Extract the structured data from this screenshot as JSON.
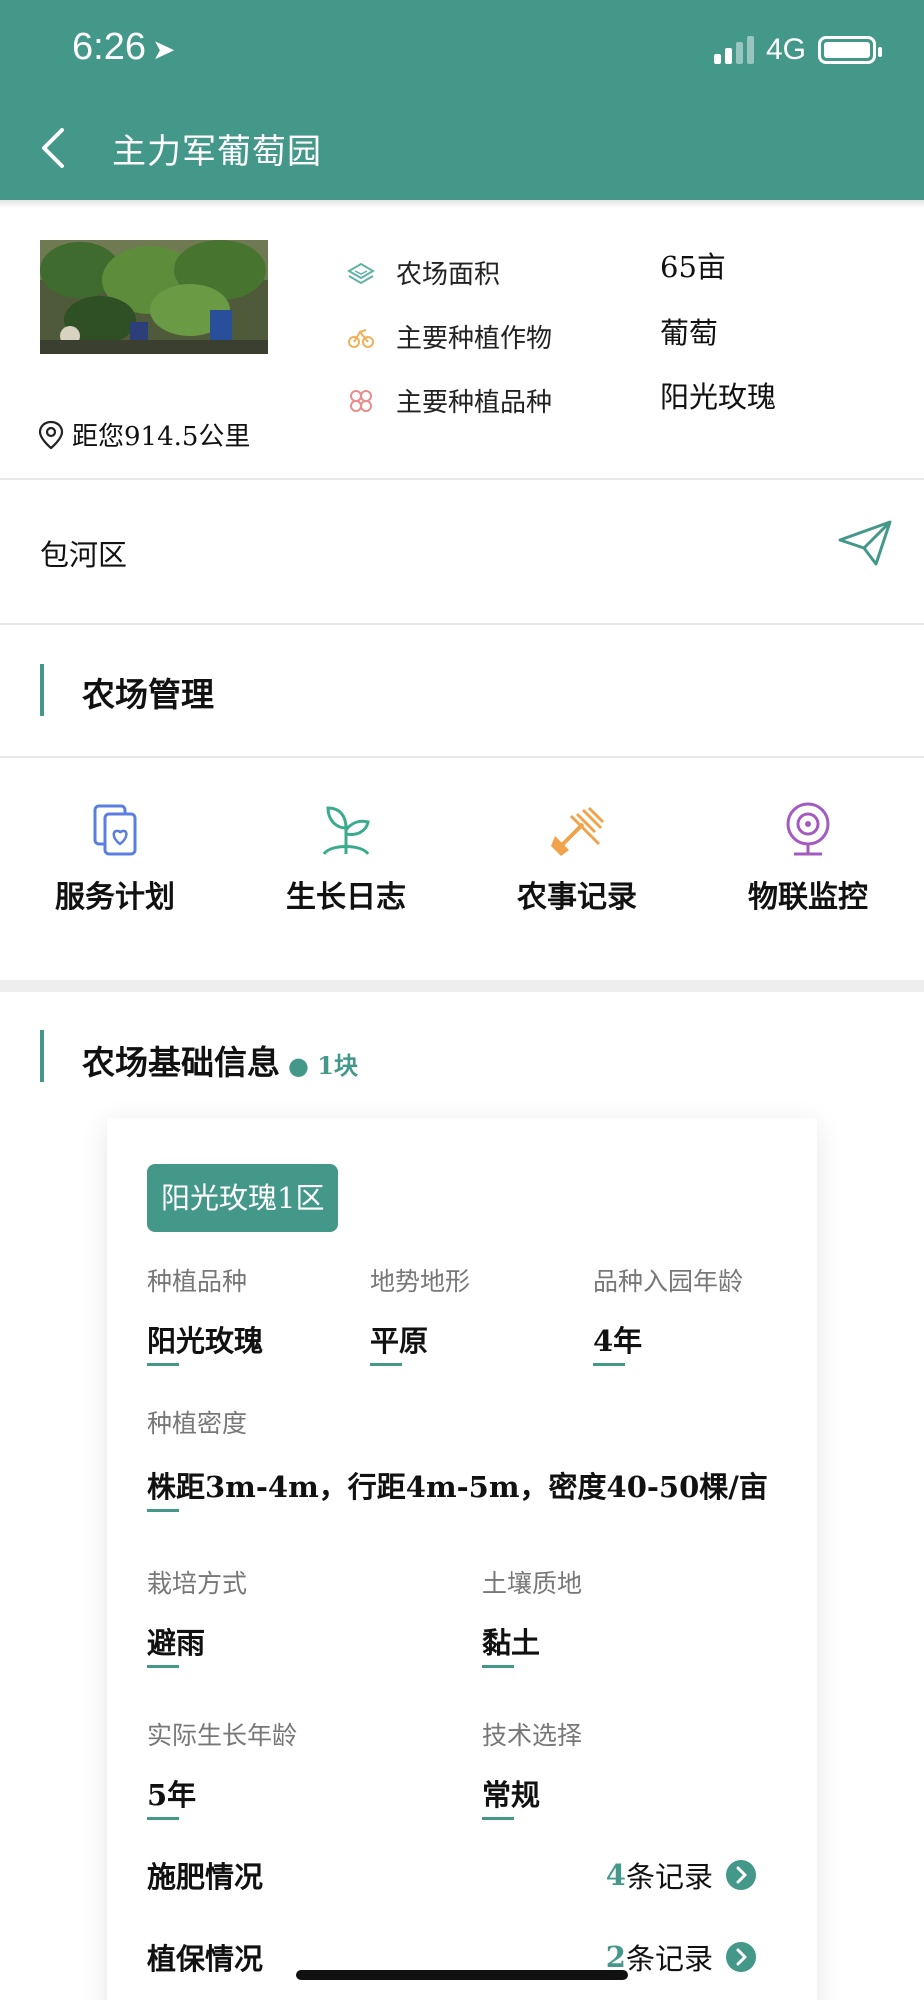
{
  "status_bar": {
    "time": "6:26",
    "network": "4G"
  },
  "header": {
    "title": "主力军葡萄园"
  },
  "farm": {
    "distance": "距您914.5公里",
    "info": [
      {
        "label": "农场面积",
        "value": "65亩",
        "icon": "area-icon"
      },
      {
        "label": "主要种植作物",
        "value": "葡萄",
        "icon": "crop-icon"
      },
      {
        "label": "主要种植品种",
        "value": "阳光玫瑰",
        "icon": "variety-icon"
      }
    ],
    "district": "包河区"
  },
  "management": {
    "title": "农场管理",
    "tools": [
      {
        "label": "服务计划",
        "icon": "service-plan-icon",
        "color": "#5b7fe0"
      },
      {
        "label": "生长日志",
        "icon": "seedling-icon",
        "color": "#3bab8e"
      },
      {
        "label": "农事记录",
        "icon": "farm-tools-icon",
        "color": "#f0a34a"
      },
      {
        "label": "物联监控",
        "icon": "camera-icon",
        "color": "#a35bc2"
      }
    ]
  },
  "basic_info": {
    "title": "农场基础信息",
    "count": "1块",
    "zone": {
      "name": "阳光玫瑰1区",
      "fields": {
        "variety": {
          "label": "种植品种",
          "value": "阳光玫瑰"
        },
        "terrain": {
          "label": "地势地形",
          "value": "平原"
        },
        "age_in_park": {
          "label": "品种入园年龄",
          "value": "4年"
        },
        "density": {
          "label": "种植密度",
          "value": "株距3m-4m，行距4m-5m，密度40-50棵/亩"
        },
        "cultivation": {
          "label": "栽培方式",
          "value": "避雨"
        },
        "soil": {
          "label": "土壤质地",
          "value": "黏土"
        },
        "actual_age": {
          "label": "实际生长年龄",
          "value": "5年"
        },
        "technique": {
          "label": "技术选择",
          "value": "常规"
        }
      },
      "records": [
        {
          "label": "施肥情况",
          "count": "4",
          "unit": "条记录"
        },
        {
          "label": "植保情况",
          "count": "2",
          "unit": "条记录"
        }
      ]
    }
  },
  "colors": {
    "brand": "#44988a"
  }
}
